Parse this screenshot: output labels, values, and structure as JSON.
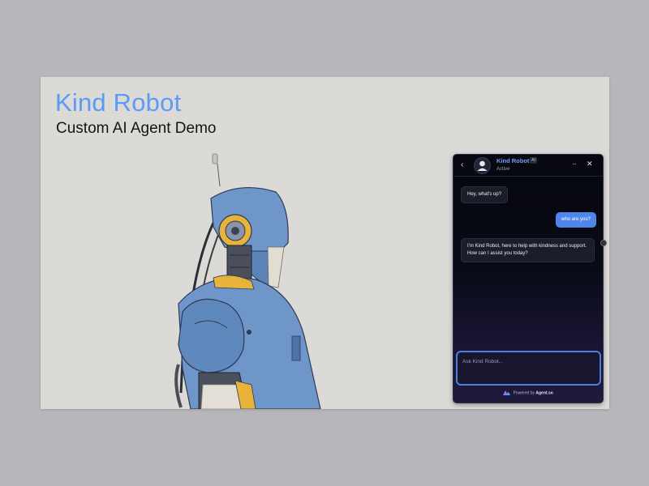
{
  "slide": {
    "title": "Kind Robot",
    "subtitle": "Custom AI Agent Demo"
  },
  "colors": {
    "accent": "#5b9af5",
    "user_bubble": "#4f86ea",
    "robot_body": "#6f96c8",
    "robot_accent": "#e8b23b"
  },
  "chat": {
    "header": {
      "back_icon": "chevron-left-icon",
      "agent_name": "Kind Robot",
      "badge": "AI",
      "status": "Active",
      "more_icon": "more-icon",
      "close_icon": "close-icon"
    },
    "messages": [
      {
        "role": "agent",
        "text": "Hey, what's up?"
      },
      {
        "role": "user",
        "text": "who are you?"
      },
      {
        "role": "agent",
        "text": "I'm Kind Robot, here to help with kindness and support. How can I assist you today?"
      }
    ],
    "input": {
      "placeholder": "Ask Kind Robot..."
    },
    "footer": {
      "powered_by": "Powered by",
      "brand": "Agent.so"
    }
  }
}
